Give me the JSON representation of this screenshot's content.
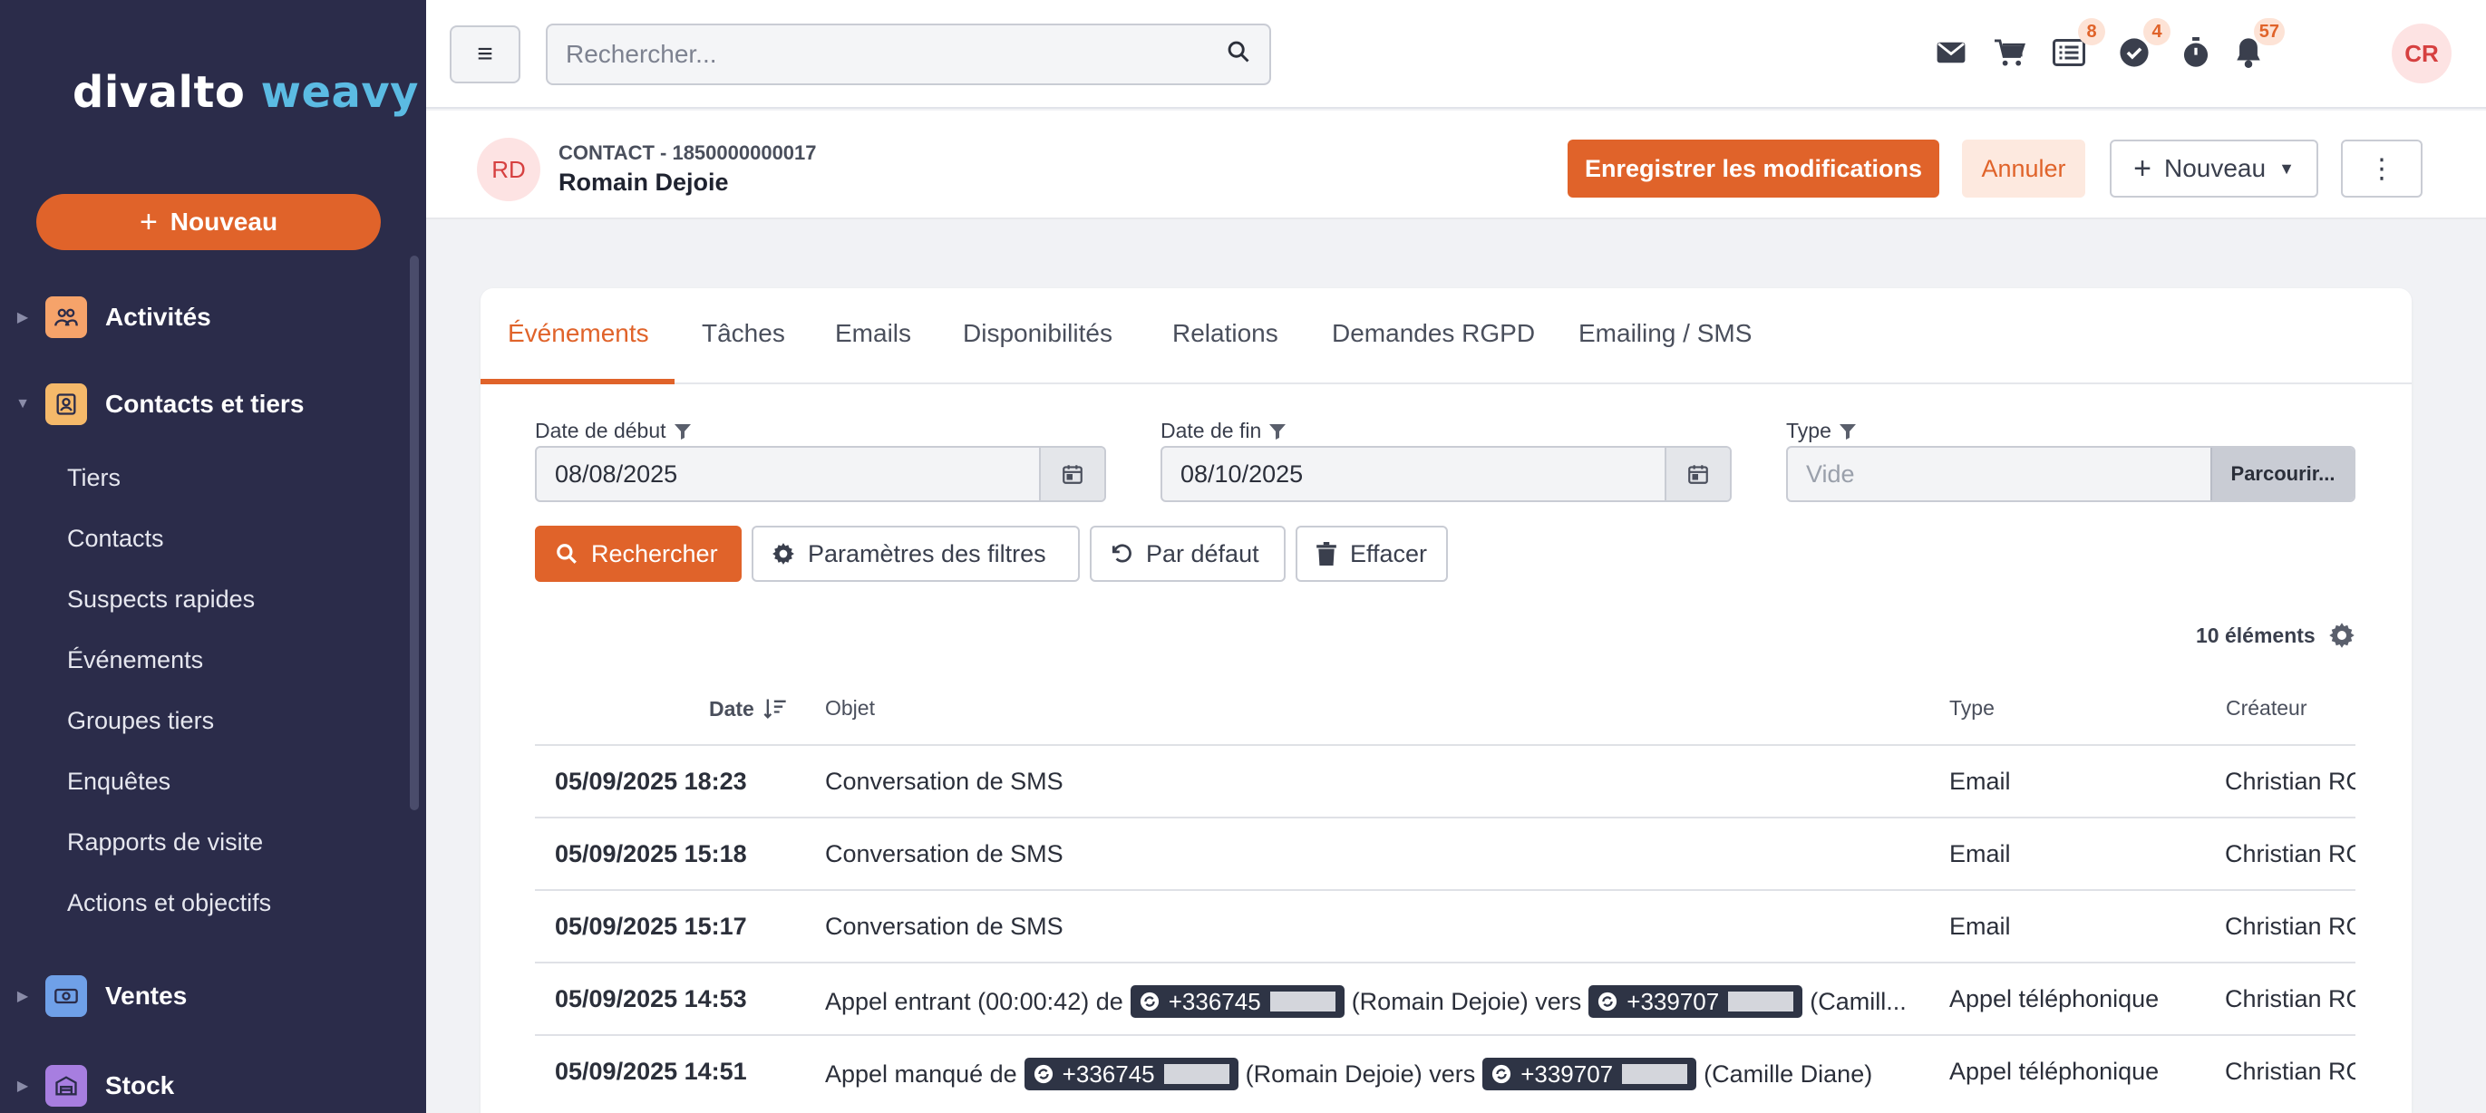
{
  "sidebar": {
    "logo_main": "divalto",
    "logo_accent": "weavy",
    "new_label": "Nouveau",
    "categories": [
      {
        "label": "Activités",
        "color": "#f6a36a"
      },
      {
        "label": "Contacts et tiers",
        "color": "#f5b96a"
      },
      {
        "label": "Ventes",
        "color": "#6fa0e8"
      },
      {
        "label": "Stock",
        "color": "#a77ee0"
      }
    ],
    "contacts_items": [
      "Tiers",
      "Contacts",
      "Suspects rapides",
      "Événements",
      "Groupes tiers",
      "Enquêtes",
      "Rapports de visite",
      "Actions et objectifs"
    ]
  },
  "topbar": {
    "search_placeholder": "Rechercher...",
    "badges": {
      "list": "8",
      "tasks": "4",
      "notifications": "57"
    },
    "user_initials": "CR"
  },
  "record": {
    "avatar": "RD",
    "kicker": "CONTACT - 1850000000017",
    "name": "Romain Dejoie",
    "save_label": "Enregistrer les modifications",
    "cancel_label": "Annuler",
    "new_label": "Nouveau"
  },
  "tabs": [
    "Événements",
    "Tâches",
    "Emails",
    "Disponibilités",
    "Relations",
    "Demandes RGPD",
    "Emailing / SMS"
  ],
  "filters": {
    "start_label": "Date de début",
    "start_value": "08/08/2025",
    "end_label": "Date de fin",
    "end_value": "08/10/2025",
    "type_label": "Type",
    "type_placeholder": "Vide",
    "browse_label": "Parcourir..."
  },
  "actions": {
    "search": "Rechercher",
    "filter_params": "Paramètres des filtres",
    "default": "Par défaut",
    "clear": "Effacer"
  },
  "table": {
    "count": "10 éléments",
    "headers": {
      "date": "Date",
      "object": "Objet",
      "type": "Type",
      "creator": "Créateur"
    },
    "rows": [
      {
        "date": "05/09/2025 18:23",
        "object": "Conversation de SMS",
        "type": "Email",
        "creator": "Christian RO"
      },
      {
        "date": "05/09/2025 15:18",
        "object": "Conversation de SMS",
        "type": "Email",
        "creator": "Christian RO"
      },
      {
        "date": "05/09/2025 15:17",
        "object": "Conversation de SMS",
        "type": "Email",
        "creator": "Christian RO"
      },
      {
        "date": "05/09/2025 14:53",
        "object_prefix": "Appel entrant (00:00:42) de",
        "phone1": "+336745",
        "mid": "(Romain Dejoie) vers",
        "phone2": "+339707",
        "suffix": "(Camill...",
        "type": "Appel téléphonique",
        "creator": "Christian RO"
      },
      {
        "date": "05/09/2025 14:51",
        "object_prefix": "Appel manqué de",
        "phone1": "+336745",
        "mid": "(Romain Dejoie) vers",
        "phone2": "+339707",
        "suffix": "(Camille Diane)",
        "type": "Appel téléphonique",
        "creator": "Christian RO"
      }
    ]
  },
  "colors": {
    "accent": "#e0632a",
    "sidebar_bg": "#2b2c4a",
    "logo_accent": "#5bbbe3"
  }
}
